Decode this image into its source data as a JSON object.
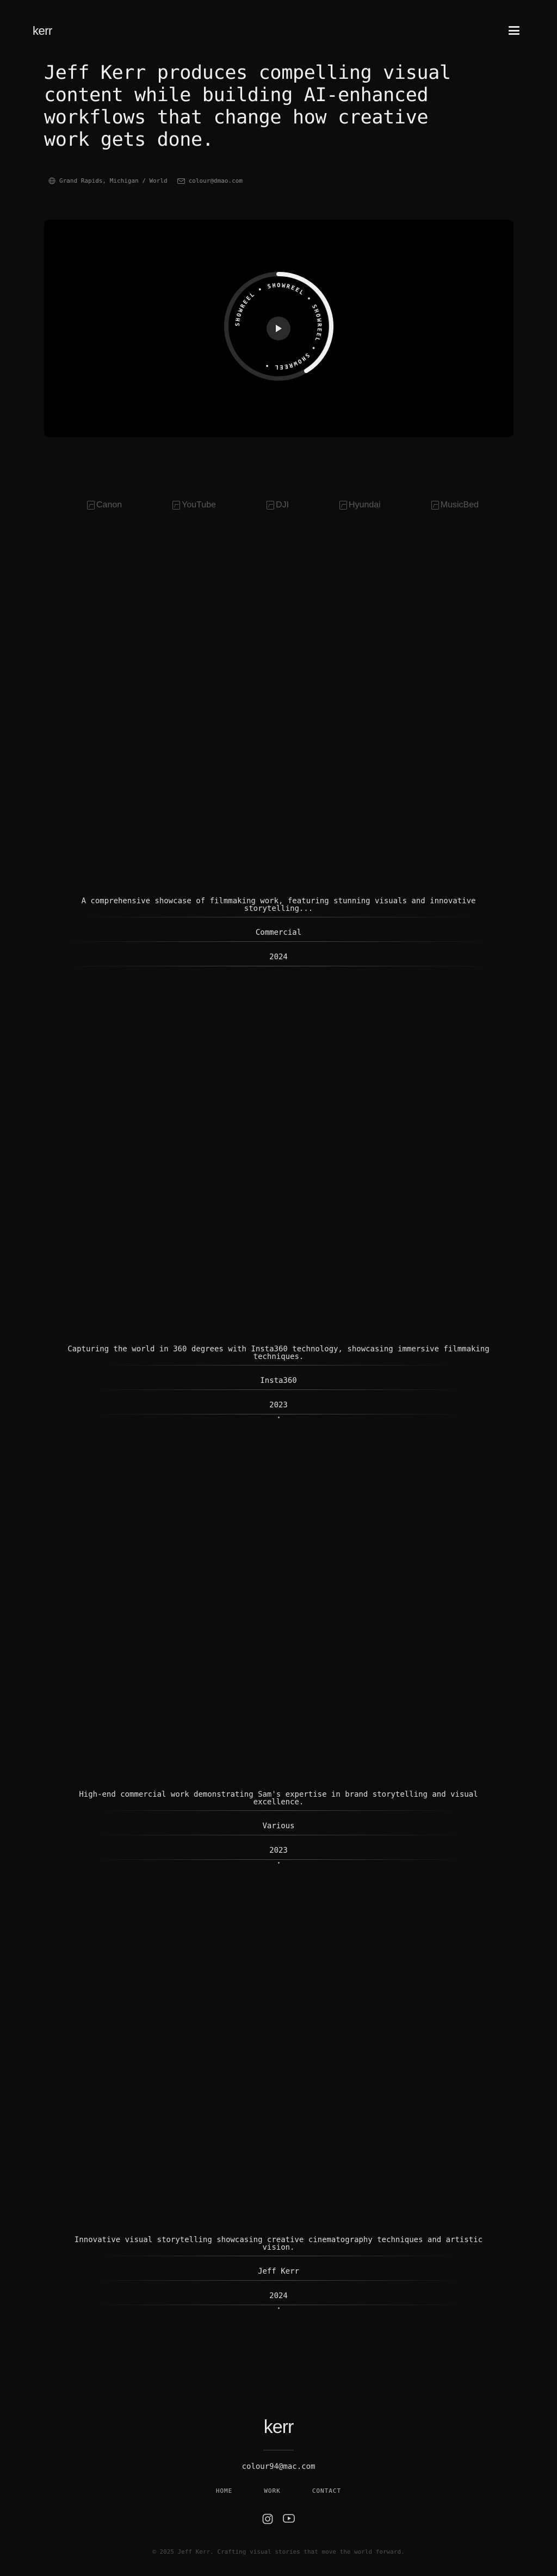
{
  "header": {
    "logo": "kerr",
    "menu_icon": "hamburger-menu-icon"
  },
  "hero": {
    "headline": "Jeff Kerr produces compelling visual content while building AI-enhanced workflows that change how creative work gets done.",
    "location": "Grand Rapids, Michigan / World",
    "email": "colour@dmao.com",
    "location_icon": "globe-icon",
    "email_icon": "mail-icon"
  },
  "video": {
    "ring_text": "SHOWREEL • SHOWREEL • SHOWREEL • SHOWREEL • ",
    "play_icon": "play-icon"
  },
  "clients": [
    {
      "name": "Canon"
    },
    {
      "name": "YouTube"
    },
    {
      "name": "DJI"
    },
    {
      "name": "Hyundai"
    },
    {
      "name": "MusicBed"
    }
  ],
  "projects": [
    {
      "description": "A comprehensive showcase of filmmaking work, featuring stunning visuals and innovative storytelling...",
      "client": "Commercial",
      "year": "2024"
    },
    {
      "description": "Capturing the world in 360 degrees with Insta360 technology, showcasing immersive filmmaking techniques.",
      "client": "Insta360",
      "year": "2023"
    },
    {
      "description": "High-end commercial work demonstrating Sam's expertise in brand storytelling and visual excellence.",
      "client": "Various",
      "year": "2023"
    },
    {
      "description": "Innovative visual storytelling showcasing creative cinematography techniques and artistic vision.",
      "client": "Jeff Kerr",
      "year": "2024"
    }
  ],
  "footer": {
    "logo": "kerr",
    "email": "colour94@mac.com",
    "nav": [
      "HOME",
      "WORK",
      "CONTACT"
    ],
    "social_icons": [
      "instagram-icon",
      "youtube-icon"
    ],
    "copyright": "© 2025 Jeff Kerr. Crafting visual stories that move the world forward."
  },
  "colors": {
    "background": "#0c0c0c",
    "text": "#e8e8e8",
    "muted": "#8a8a8a"
  }
}
